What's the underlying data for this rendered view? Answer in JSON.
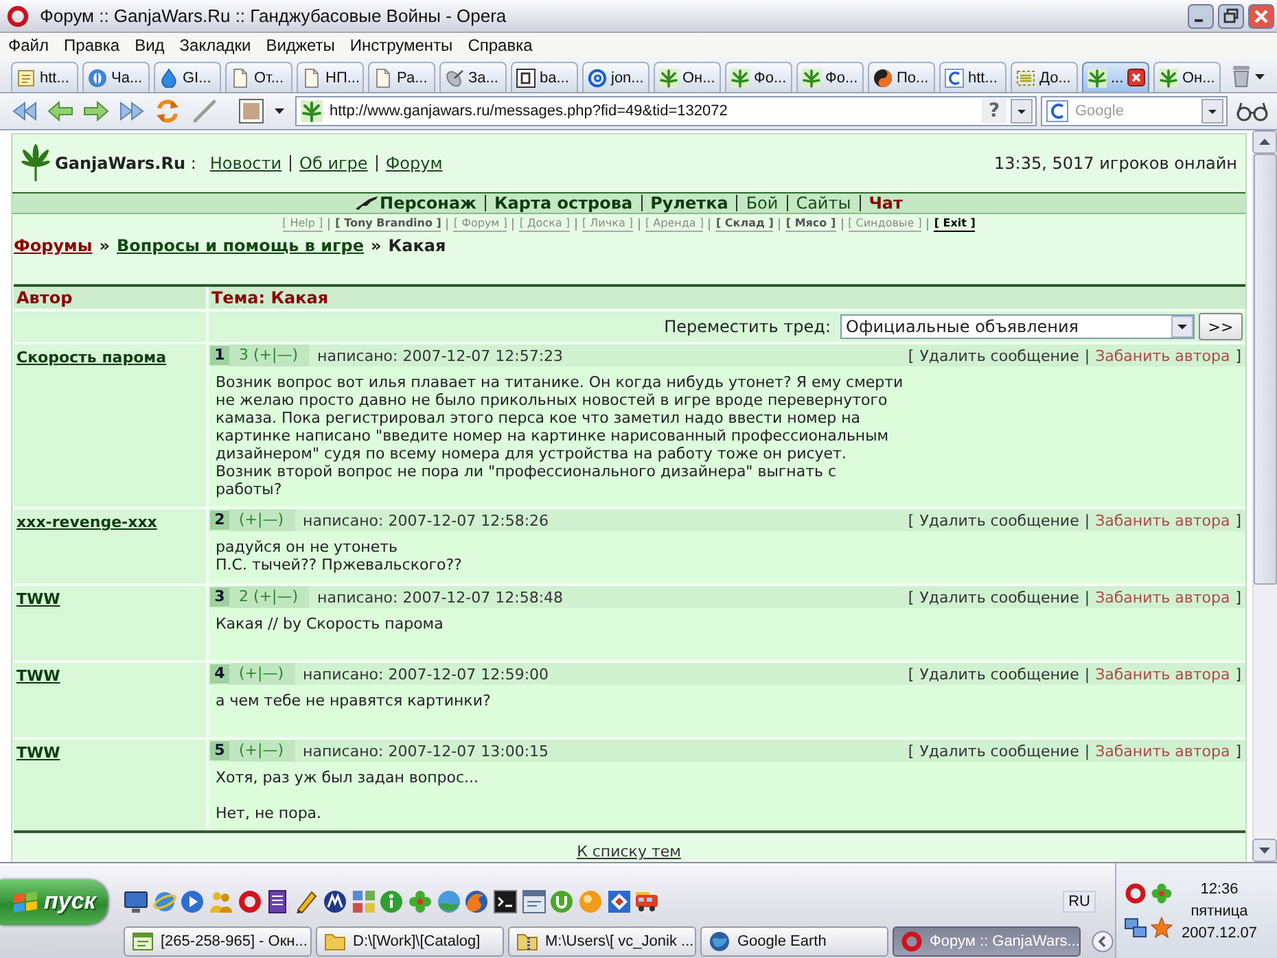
{
  "window": {
    "title": "Форум :: GanjaWars.Ru :: Ганджубасовые Войны - Opera"
  },
  "menu": [
    "Файл",
    "Правка",
    "Вид",
    "Закладки",
    "Виджеты",
    "Инструменты",
    "Справка"
  ],
  "tabs": [
    {
      "label": "htt...",
      "kind": "note",
      "selected": false
    },
    {
      "label": "Ча...",
      "kind": "orb",
      "selected": false
    },
    {
      "label": "GI...",
      "kind": "drop",
      "selected": false
    },
    {
      "label": "От...",
      "kind": "page",
      "selected": false
    },
    {
      "label": "НП...",
      "kind": "page",
      "selected": false
    },
    {
      "label": "Ра...",
      "kind": "page",
      "selected": false
    },
    {
      "label": "За...",
      "kind": "dish",
      "selected": false
    },
    {
      "label": "ba...",
      "kind": "framed",
      "selected": false
    },
    {
      "label": "jon...",
      "kind": "ring",
      "selected": false
    },
    {
      "label": "Он...",
      "kind": "leaf",
      "selected": false
    },
    {
      "label": "Фо...",
      "kind": "leaf",
      "selected": false
    },
    {
      "label": "Фо...",
      "kind": "leaf",
      "selected": false
    },
    {
      "label": "По...",
      "kind": "ball",
      "selected": false
    },
    {
      "label": "htt...",
      "kind": "arc",
      "selected": false
    },
    {
      "label": "До...",
      "kind": "frame",
      "selected": false
    },
    {
      "label": "...",
      "kind": "leaf",
      "selected": true
    },
    {
      "label": "Он...",
      "kind": "leaf",
      "selected": false
    }
  ],
  "toolbar": {
    "url": "http://www.ganjawars.ru/messages.php?fid=49&tid=132072",
    "help_button": "?",
    "search": {
      "placeholder": "Google"
    }
  },
  "page": {
    "header": {
      "title": "**GanjaWars.Ru** :",
      "links": [
        "Новости",
        "Об игре",
        "Форум"
      ],
      "online": "13:35, 5017 игроков онлайн"
    },
    "nav": [
      {
        "label": "Персонаж",
        "kind": "character"
      },
      {
        "label": "Карта острова",
        "kind": "main"
      },
      {
        "label": "Рулетка",
        "kind": "main"
      },
      {
        "label": "Бой",
        "kind": "plain"
      },
      {
        "label": "Сайты",
        "kind": "plain"
      },
      {
        "label": "Чат",
        "kind": "alert"
      }
    ],
    "quick_links": [
      {
        "label": "[ Help ]",
        "kind": "dim"
      },
      {
        "label": "[ Tony Brandino ]",
        "kind": "bold"
      },
      {
        "label": "[ Форум ]",
        "kind": "dim"
      },
      {
        "label": "[ Доска ]",
        "kind": "dim"
      },
      {
        "label": "[ Личка ]",
        "kind": "dim"
      },
      {
        "label": "[ Аренда ]",
        "kind": "dim"
      },
      {
        "label": "[ Склад ]",
        "kind": "bold"
      },
      {
        "label": "[ Мясо ]",
        "kind": "bold"
      },
      {
        "label": "[ Синдовые ]",
        "kind": "dim"
      },
      {
        "label": "[ Exit ]",
        "kind": "strong"
      }
    ],
    "breadcrumb": [
      {
        "label": "Форумы",
        "kind": "section"
      },
      {
        "label": "»",
        "kind": "sep"
      },
      {
        "label": "Вопросы и помощь в игре",
        "kind": "forum"
      },
      {
        "label": "»",
        "kind": "sep"
      },
      {
        "label": "Какая",
        "kind": "current"
      }
    ],
    "table": {
      "columns": [
        "Автор",
        "Тема: Какая"
      ],
      "move_thread": {
        "label": "Переместить тред:",
        "value": "Официальные объявления",
        "button": ">>"
      },
      "posts": [
        {
          "author": "Скорость парома",
          "number": "1",
          "rating": "3 (+|—)",
          "posted": "написано: 2007-12-07 12:57:23",
          "actions": [
            {
              "label": "[",
              "kind": "bracket"
            },
            {
              "label": "Удалить сообщение",
              "kind": "delete"
            },
            {
              "label": "|",
              "kind": "sep"
            },
            {
              "label": "Забанить автора",
              "kind": "ban"
            },
            {
              "label": "]",
              "kind": "bracket"
            }
          ],
          "paragraphs": [
            [
              "Возник вопрос вот илья плавает на титанике. Он когда нибудь утонет? Я ему смерти",
              "не желаю просто давно не было прикольных новостей в игре вроде перевернутого",
              "камаза. Пока регистрировал этого перса кое что заметил надо ввести номер на",
              "картинке написано \"введите номер на картинке нарисованный профессиональным",
              "дизайнером\" судя по всему номера для устройства на работу тоже он рисует.",
              "Возник второй вопрос не пора ли \"профессионального дизайнера\" выгнать с",
              "работы?"
            ]
          ]
        },
        {
          "author": "xxx-revenge-xxx",
          "number": "2",
          "rating": "(+|—)",
          "posted": "написано: 2007-12-07 12:58:26",
          "actions": [
            {
              "label": "[",
              "kind": "bracket"
            },
            {
              "label": "Удалить сообщение",
              "kind": "delete"
            },
            {
              "label": "|",
              "kind": "sep"
            },
            {
              "label": "Забанить автора",
              "kind": "ban"
            },
            {
              "label": "]",
              "kind": "bracket"
            }
          ],
          "paragraphs": [
            [
              "радуйся он не утонеть",
              "П.С. тычей?? Пржевальского??"
            ]
          ]
        },
        {
          "author": "TWW",
          "number": "3",
          "rating": "2 (+|—)",
          "posted": "написано: 2007-12-07 12:58:48",
          "actions": [
            {
              "label": "[",
              "kind": "bracket"
            },
            {
              "label": "Удалить сообщение",
              "kind": "delete"
            },
            {
              "label": "|",
              "kind": "sep"
            },
            {
              "label": "Забанить автора",
              "kind": "ban"
            },
            {
              "label": "]",
              "kind": "bracket"
            }
          ],
          "paragraphs": [
            [
              "Какая // by Скорость парома"
            ]
          ]
        },
        {
          "author": "TWW",
          "number": "4",
          "rating": "(+|—)",
          "posted": "написано: 2007-12-07 12:59:00",
          "actions": [
            {
              "label": "[",
              "kind": "bracket"
            },
            {
              "label": "Удалить сообщение",
              "kind": "delete"
            },
            {
              "label": "|",
              "kind": "sep"
            },
            {
              "label": "Забанить автора",
              "kind": "ban"
            },
            {
              "label": "]",
              "kind": "bracket"
            }
          ],
          "paragraphs": [
            [
              "а чем тебе не нравятся картинки?"
            ]
          ]
        },
        {
          "author": "TWW",
          "number": "5",
          "rating": "(+|—)",
          "posted": "написано: 2007-12-07 13:00:15",
          "actions": [
            {
              "label": "[",
              "kind": "bracket"
            },
            {
              "label": "Удалить сообщение",
              "kind": "delete"
            },
            {
              "label": "|",
              "kind": "sep"
            },
            {
              "label": "Забанить автора",
              "kind": "ban"
            },
            {
              "label": "]",
              "kind": "bracket"
            }
          ],
          "paragraphs": [
            [
              "Хотя, раз уж был задан вопрос..."
            ],
            [
              "Нет, не пора."
            ]
          ]
        }
      ]
    },
    "back_link": "К списку тем"
  },
  "taskbar": {
    "start": "пуск",
    "language": "RU",
    "buttons": [
      {
        "label": "[265-258-965] - Окн...",
        "kind": "chat",
        "selected": false
      },
      {
        "label": "D:\\[Work]\\[Catalog]",
        "kind": "folder",
        "selected": false
      },
      {
        "label": "M:\\Users\\[ vc_Jonik ...",
        "kind": "archive",
        "selected": false
      },
      {
        "label": "Google Earth",
        "kind": "earth",
        "selected": false
      },
      {
        "label": "Форум :: GanjaWars...",
        "kind": "opera",
        "selected": true
      }
    ],
    "clock": {
      "time": "12:36",
      "day": "пятница",
      "date": "2007.12.07"
    }
  }
}
